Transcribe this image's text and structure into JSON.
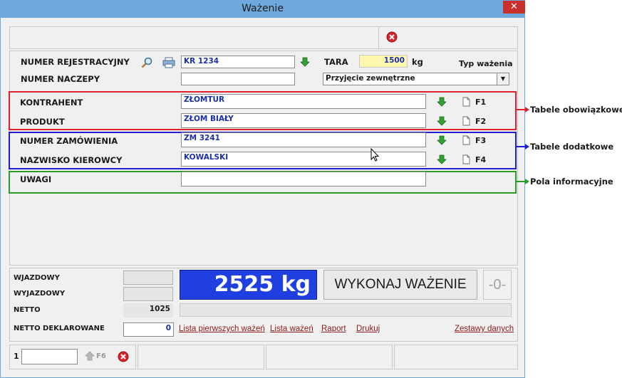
{
  "window": {
    "title": "Ważenie",
    "close_glyph": "✕"
  },
  "form": {
    "numer_rejestracyjny": {
      "label": "NUMER REJESTRACYJNY",
      "value": "KR 1234"
    },
    "numer_naczepy": {
      "label": "NUMER NACZEPY",
      "value": ""
    },
    "tara": {
      "label": "TARA",
      "value": "1500",
      "unit": "kg"
    },
    "typ_wazenia": {
      "label": "Typ ważenia",
      "value": "Przyjęcie zewnętrzne"
    },
    "kontrahent": {
      "label": "KONTRAHENT",
      "value": "ZŁOMTUR",
      "key": "F1"
    },
    "produkt": {
      "label": "PRODUKT",
      "value": "ZŁOM BIAŁY",
      "key": "F2"
    },
    "numer_zamowienia": {
      "label": "NUMER ZAMÓWIENIA",
      "value": "ZM 3241",
      "key": "F3"
    },
    "nazwisko_kierowcy": {
      "label": "NAZWISKO KIEROWCY",
      "value": "KOWALSKI",
      "key": "F4"
    },
    "uwagi": {
      "label": "UWAGI",
      "value": ""
    }
  },
  "weights": {
    "wjazdowy": {
      "label": "WJAZDOWY",
      "value": ""
    },
    "wyjazdowy": {
      "label": "WYJAZDOWY",
      "value": ""
    },
    "netto": {
      "label": "NETTO",
      "value": "1025"
    },
    "netto_deklarowane": {
      "label": "NETTO DEKLAROWANE",
      "value": "0"
    },
    "display": "2525 kg",
    "wykonaj_button": "WYKONAJ WAŻENIE",
    "status": "-0-"
  },
  "links": [
    "Lista pierwszych ważeń",
    "Lista ważeń",
    "Raport",
    "Drukuj",
    "Zestawy danych"
  ],
  "footer": {
    "counter": "1",
    "f6_label": "F6"
  },
  "annotations": {
    "red": "Tabele obowiązkowe",
    "blue": "Tabele dodatkowe",
    "green": "Pola informacyjne"
  },
  "colors": {
    "red": "#e0202a",
    "blue": "#1f1fd0",
    "green": "#2a9a2a",
    "display_bg": "#1f3fe0",
    "tara_bg": "#fff7b0"
  }
}
